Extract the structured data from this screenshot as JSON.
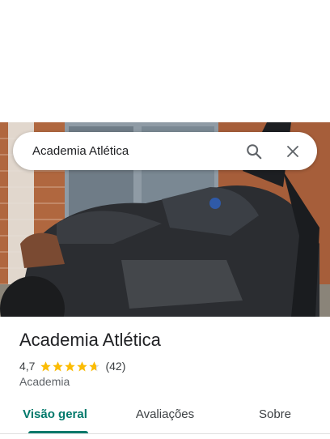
{
  "search": {
    "query": "Academia Atlética"
  },
  "icons": {
    "search": "search-icon",
    "close": "close-icon",
    "star": "star-icon"
  },
  "place": {
    "name": "Academia Atlética",
    "rating": "4,7",
    "rating_stars": 4.7,
    "reviews_count": "(42)",
    "category": "Academia"
  },
  "tabs": [
    {
      "label": "Visão geral",
      "active": true
    },
    {
      "label": "Avaliações",
      "active": false
    },
    {
      "label": "Sobre",
      "active": false
    }
  ],
  "colors": {
    "accent": "#00796b",
    "star": "#fbbc04"
  }
}
